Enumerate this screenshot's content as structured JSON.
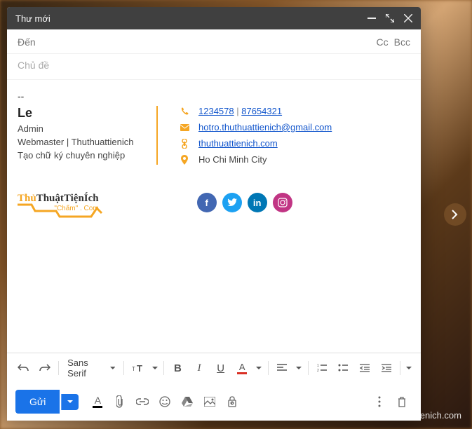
{
  "header": {
    "title": "Thư mới"
  },
  "recipients": {
    "label": "Đến",
    "cc": "Cc",
    "bcc": "Bcc"
  },
  "subject": {
    "placeholder": "Chủ đề"
  },
  "signature": {
    "separator": "--",
    "name": "Le",
    "role1": "Admin",
    "role2": "Webmaster | Thuthuattienich",
    "role3": "Tạo chữ ký chuyên nghiệp",
    "phone1": "1234578",
    "phone2": "87654321",
    "email": "hotro.thuthuattienich@gmail.com",
    "website": "thuthuattienich.com",
    "location": "Ho Chi Minh City"
  },
  "logo": {
    "part1": "Thủ",
    "part2": "ThuậtTiệnÍch",
    "sub": "\"Chấm\" . Com"
  },
  "toolbar": {
    "font": "Sans Serif",
    "bold": "B",
    "italic": "I",
    "underline": "U",
    "textcolor": "A"
  },
  "send": {
    "label": "Gửi"
  },
  "textformat": "A",
  "watermark": "Thuthuattienich.com",
  "colors": {
    "accent": "#f5a623",
    "primary": "#1a73e8",
    "link": "#1155cc"
  }
}
